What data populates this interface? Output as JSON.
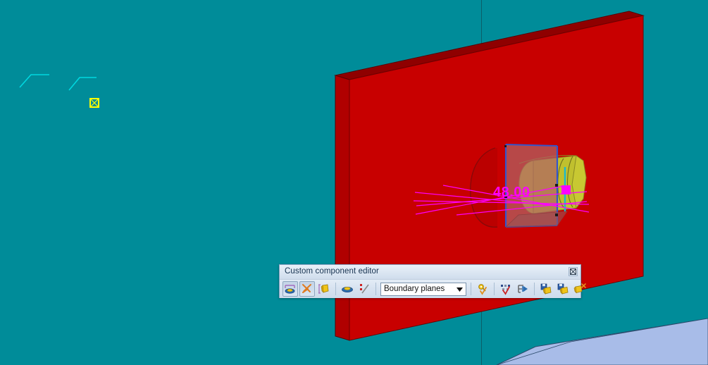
{
  "scene": {
    "background_color": "#008C99",
    "slab_color": "#c80000",
    "slab_top_color": "#8f0000",
    "cylinder_color": "#c8c832",
    "plane_color": "#b06464",
    "plane_edge_color": "#3355cc",
    "dimension_label": "48.00",
    "dimension_color": "#ff00ff",
    "marker_color": "#ff00ff",
    "ground_plane_color": "#a8bce8",
    "snap_marker_color": "#ffff00",
    "polyline_color": "#00d8e0"
  },
  "dialog": {
    "title": "Custom component editor",
    "close_icon": "close-icon",
    "toolbar": {
      "buttons": [
        {
          "name": "construction-plane-button",
          "icon": "construction-plane-icon",
          "pressed": true,
          "label": "Construction plane"
        },
        {
          "name": "construction-line-button",
          "icon": "construction-line-icon",
          "pressed": true,
          "label": "Construction line"
        },
        {
          "name": "construction-point-button",
          "icon": "construction-point-icon",
          "pressed": false,
          "label": "Construction point"
        },
        {
          "name": "separator-1",
          "icon": "separator",
          "pressed": false,
          "label": ""
        },
        {
          "name": "show-plane-button",
          "icon": "plane-visibility-icon",
          "pressed": false,
          "label": "Show planes"
        },
        {
          "name": "show-line-point-button",
          "icon": "line-point-visibility-icon",
          "pressed": false,
          "label": "Show lines and points"
        },
        {
          "name": "separator-2",
          "icon": "separator",
          "pressed": false,
          "label": ""
        },
        {
          "name": "bind-button",
          "icon": "bind-icon",
          "pressed": false,
          "label": "Bind"
        },
        {
          "name": "separator-3",
          "icon": "separator",
          "pressed": false,
          "label": ""
        },
        {
          "name": "select-objects-button",
          "icon": "select-objects-icon",
          "pressed": false,
          "label": "Select objects"
        },
        {
          "name": "variables-button",
          "icon": "variables-icon",
          "pressed": false,
          "label": "Variables"
        },
        {
          "name": "separator-4",
          "icon": "separator",
          "pressed": false,
          "label": ""
        },
        {
          "name": "save-component-button",
          "icon": "save-component-icon",
          "pressed": false,
          "label": "Save"
        },
        {
          "name": "save-as-component-button",
          "icon": "save-as-component-icon",
          "pressed": false,
          "label": "Save as"
        },
        {
          "name": "close-component-button",
          "icon": "close-component-icon",
          "pressed": false,
          "label": "Close"
        }
      ],
      "dropdown": {
        "name": "plane-type-dropdown",
        "value": "Boundary planes",
        "arrow_icon": "chevron-down-icon"
      }
    }
  }
}
